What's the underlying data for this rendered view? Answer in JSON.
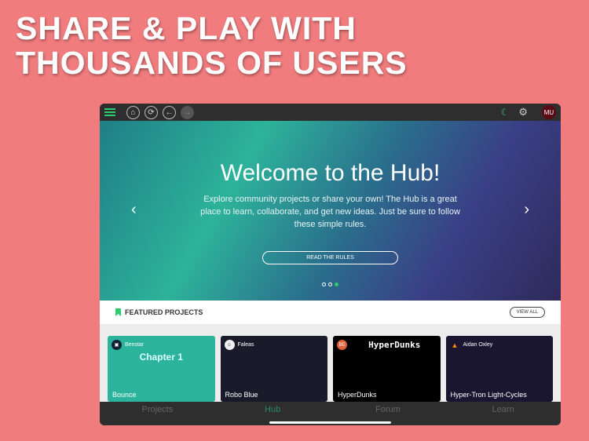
{
  "headline": {
    "line1": "SHARE & PLAY WITH",
    "line2": "THOUSANDS OF USERS"
  },
  "topbar": {
    "icons": [
      "menu-icon",
      "home-icon",
      "refresh-icon",
      "back-icon",
      "forward-icon",
      "moon-icon",
      "settings-icon"
    ],
    "avatar": "MU"
  },
  "hero": {
    "title": "Welcome to the Hub!",
    "text": "Explore community projects or share your own! The Hub is a great place to learn, collaborate, and get new ideas. Just be sure to follow these simple rules.",
    "button": "READ THE RULES",
    "slide": 3,
    "slides": 3
  },
  "featured": {
    "title": "FEATURED PROJECTS",
    "view_all": "VIEW ALL",
    "cards": [
      {
        "author": "Benstar",
        "name": "Bounce",
        "title": "Chapter 1"
      },
      {
        "author": "Faleas",
        "name": "Robo Blue"
      },
      {
        "author_initials": "BE",
        "name": "HyperDunks",
        "title": "HyperDunks"
      },
      {
        "author": "Aidan Oxley",
        "name": "Hyper-Tron Light-Cycles"
      }
    ]
  },
  "tabs": [
    "Projects",
    "Hub",
    "Forum",
    "Learn"
  ],
  "active_tab": "Hub",
  "colors": {
    "accent": "#2ecc71",
    "background": "#f07c7e"
  }
}
